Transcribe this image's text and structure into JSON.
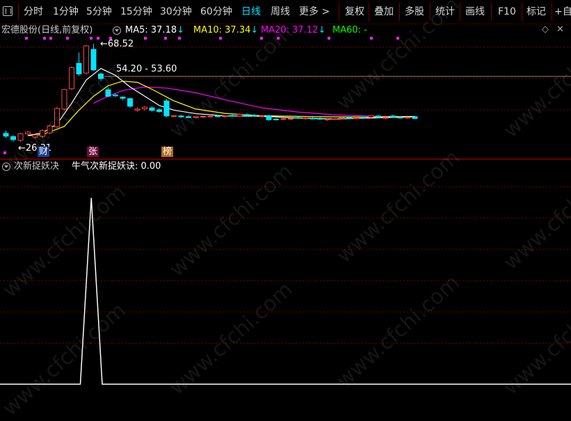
{
  "toolbar": {
    "items": [
      "分时",
      "1分钟",
      "5分钟",
      "15分钟",
      "30分钟",
      "60分钟",
      "日线",
      "周线",
      "更多 >"
    ],
    "right_items": [
      "复权",
      "叠加",
      "多股",
      "统计",
      "画线",
      "F10",
      "标记",
      "+自"
    ]
  },
  "main_panel": {
    "stock_name": "宏德股份(日线,前复权)",
    "ma5_label": "MA5: 37.18",
    "ma10_label": "MA10: 37.34",
    "ma20_label": "MA20: 37.12",
    "ma60_label": "MA60: -",
    "high_label": "68.52",
    "low_label": "26.31",
    "range_label": "54.20 - 53.60",
    "tags": [
      "财",
      "张",
      "榜"
    ]
  },
  "indicator_panel": {
    "name": "次新捉妖决",
    "value_label": "牛气次新捉妖诀: 0.00"
  },
  "watermark": "www.cfchi.com",
  "colors": {
    "up": "#ff4444",
    "down": "#00e5ff",
    "ma5": "#ffffff",
    "ma10": "#ffff00",
    "ma20": "#ff00ff",
    "ma60": "#00ff00",
    "grid": "#7a0000"
  },
  "chart_data": {
    "type": "candlestick",
    "candles": [
      {
        "o": 30.0,
        "h": 31.2,
        "l": 28.0,
        "c": 28.8
      },
      {
        "o": 28.6,
        "h": 29.2,
        "l": 26.4,
        "c": 27.3
      },
      {
        "o": 27.0,
        "h": 30.3,
        "l": 26.31,
        "c": 29.8
      },
      {
        "o": 29.8,
        "h": 31.0,
        "l": 29.0,
        "c": 30.6
      },
      {
        "o": 28.4,
        "h": 29.6,
        "l": 27.6,
        "c": 29.3
      },
      {
        "o": 28.7,
        "h": 31.8,
        "l": 27.9,
        "c": 31.2
      },
      {
        "o": 30.2,
        "h": 33.6,
        "l": 29.6,
        "c": 33.2
      },
      {
        "o": 32.8,
        "h": 41.5,
        "l": 32.3,
        "c": 40.7
      },
      {
        "o": 40.5,
        "h": 49.2,
        "l": 39.8,
        "c": 48.9
      },
      {
        "o": 49.2,
        "h": 58.8,
        "l": 48.6,
        "c": 58.3
      },
      {
        "o": 60.2,
        "h": 64.8,
        "l": 54.8,
        "c": 55.6
      },
      {
        "o": 56.0,
        "h": 68.1,
        "l": 55.4,
        "c": 67.7
      },
      {
        "o": 66.2,
        "h": 68.52,
        "l": 56.9,
        "c": 57.3
      },
      {
        "o": 55.6,
        "h": 56.2,
        "l": 52.5,
        "c": 53.6
      },
      {
        "o": 48.8,
        "h": 49.8,
        "l": 45.5,
        "c": 46.0
      },
      {
        "o": 46.5,
        "h": 47.2,
        "l": 45.6,
        "c": 46.4
      },
      {
        "o": 45.6,
        "h": 46.0,
        "l": 44.3,
        "c": 45.1
      },
      {
        "o": 45.0,
        "h": 45.4,
        "l": 41.0,
        "c": 41.7
      },
      {
        "o": 40.0,
        "h": 41.2,
        "l": 39.3,
        "c": 40.5
      },
      {
        "o": 40.6,
        "h": 41.8,
        "l": 39.7,
        "c": 41.3
      },
      {
        "o": 41.0,
        "h": 41.6,
        "l": 39.4,
        "c": 39.9
      },
      {
        "o": 40.2,
        "h": 40.8,
        "l": 38.9,
        "c": 39.4
      },
      {
        "o": 44.0,
        "h": 44.8,
        "l": 37.0,
        "c": 37.5
      },
      {
        "o": 37.3,
        "h": 37.9,
        "l": 36.9,
        "c": 37.6
      },
      {
        "o": 37.5,
        "h": 38.0,
        "l": 36.8,
        "c": 37.1
      },
      {
        "o": 37.2,
        "h": 37.8,
        "l": 36.5,
        "c": 36.8
      },
      {
        "o": 36.8,
        "h": 37.4,
        "l": 36.5,
        "c": 37.2
      },
      {
        "o": 37.0,
        "h": 37.5,
        "l": 36.6,
        "c": 37.3
      },
      {
        "o": 37.2,
        "h": 37.6,
        "l": 36.9,
        "c": 37.4
      },
      {
        "o": 37.5,
        "h": 38.0,
        "l": 37.0,
        "c": 37.4
      },
      {
        "o": 37.2,
        "h": 37.6,
        "l": 36.8,
        "c": 37.5
      },
      {
        "o": 37.7,
        "h": 38.3,
        "l": 37.2,
        "c": 37.4
      },
      {
        "o": 37.5,
        "h": 38.6,
        "l": 37.3,
        "c": 38.2
      },
      {
        "o": 38.1,
        "h": 38.6,
        "l": 37.3,
        "c": 37.7
      },
      {
        "o": 37.8,
        "h": 38.3,
        "l": 37.4,
        "c": 37.6
      },
      {
        "o": 37.3,
        "h": 37.9,
        "l": 36.8,
        "c": 37.5
      },
      {
        "o": 37.5,
        "h": 38.0,
        "l": 35.4,
        "c": 35.9
      },
      {
        "o": 36.1,
        "h": 36.5,
        "l": 35.6,
        "c": 36.0
      },
      {
        "o": 36.2,
        "h": 36.6,
        "l": 35.8,
        "c": 36.3
      },
      {
        "o": 36.1,
        "h": 36.7,
        "l": 35.7,
        "c": 36.4
      },
      {
        "o": 36.8,
        "h": 37.2,
        "l": 36.3,
        "c": 36.5
      },
      {
        "o": 36.4,
        "h": 36.9,
        "l": 35.9,
        "c": 36.6
      },
      {
        "o": 36.5,
        "h": 37.0,
        "l": 36.1,
        "c": 36.3
      },
      {
        "o": 36.5,
        "h": 36.9,
        "l": 35.8,
        "c": 36.1
      },
      {
        "o": 35.8,
        "h": 36.4,
        "l": 35.4,
        "c": 36.1
      },
      {
        "o": 36.2,
        "h": 36.6,
        "l": 35.9,
        "c": 36.3
      },
      {
        "o": 36.6,
        "h": 37.1,
        "l": 36.2,
        "c": 36.7
      },
      {
        "o": 36.8,
        "h": 37.2,
        "l": 36.1,
        "c": 36.5
      },
      {
        "o": 36.5,
        "h": 37.0,
        "l": 36.1,
        "c": 36.6
      },
      {
        "o": 36.9,
        "h": 37.3,
        "l": 36.4,
        "c": 36.7
      },
      {
        "o": 37.0,
        "h": 37.9,
        "l": 36.4,
        "c": 37.7
      },
      {
        "o": 37.5,
        "h": 37.9,
        "l": 36.6,
        "c": 36.9
      },
      {
        "o": 36.6,
        "h": 37.1,
        "l": 36.0,
        "c": 36.8
      },
      {
        "o": 37.5,
        "h": 38.0,
        "l": 36.7,
        "c": 37.0
      },
      {
        "o": 36.9,
        "h": 37.4,
        "l": 36.5,
        "c": 36.7
      },
      {
        "o": 36.7,
        "h": 37.2,
        "l": 36.3,
        "c": 36.9
      },
      {
        "o": 37.2,
        "h": 37.6,
        "l": 36.2,
        "c": 36.4
      }
    ],
    "ma10": [
      [
        3,
        29.0
      ],
      [
        5,
        29.5
      ],
      [
        8,
        33.0
      ],
      [
        10,
        40.0
      ],
      [
        12,
        46.0
      ],
      [
        14,
        50.5
      ],
      [
        16,
        52.5
      ],
      [
        18,
        52.0
      ],
      [
        20,
        49.0
      ],
      [
        23,
        44.0
      ],
      [
        26,
        40.5
      ],
      [
        30,
        38.6
      ],
      [
        35,
        37.6
      ],
      [
        42,
        37.2
      ],
      [
        50,
        37.0
      ],
      [
        56,
        37.34
      ]
    ],
    "ma5": [
      [
        3,
        29.1
      ],
      [
        5,
        30.2
      ],
      [
        7,
        34.0
      ],
      [
        9,
        43.0
      ],
      [
        11,
        53.0
      ],
      [
        13,
        58.0
      ],
      [
        15,
        55.0
      ],
      [
        17,
        50.0
      ],
      [
        19,
        46.0
      ],
      [
        21,
        42.0
      ],
      [
        23,
        40.0
      ],
      [
        26,
        38.5
      ],
      [
        30,
        37.5
      ],
      [
        35,
        37.4
      ],
      [
        40,
        36.6
      ],
      [
        45,
        36.2
      ],
      [
        50,
        36.6
      ],
      [
        56,
        37.18
      ]
    ],
    "ma20": [
      [
        12,
        43.0
      ],
      [
        14,
        46.0
      ],
      [
        16,
        48.5
      ],
      [
        19,
        50.0
      ],
      [
        22,
        49.5
      ],
      [
        26,
        47.5
      ],
      [
        30,
        44.5
      ],
      [
        35,
        41.0
      ],
      [
        40,
        39.2
      ],
      [
        45,
        38.0
      ],
      [
        50,
        37.4
      ],
      [
        56,
        37.12
      ]
    ],
    "indicator": [
      [
        0,
        0
      ],
      [
        10,
        0
      ],
      [
        11.5,
        9
      ],
      [
        13,
        0
      ],
      [
        56,
        0
      ]
    ],
    "ylim": [
      24,
      71
    ],
    "indicator_ylim": [
      0,
      10
    ]
  }
}
